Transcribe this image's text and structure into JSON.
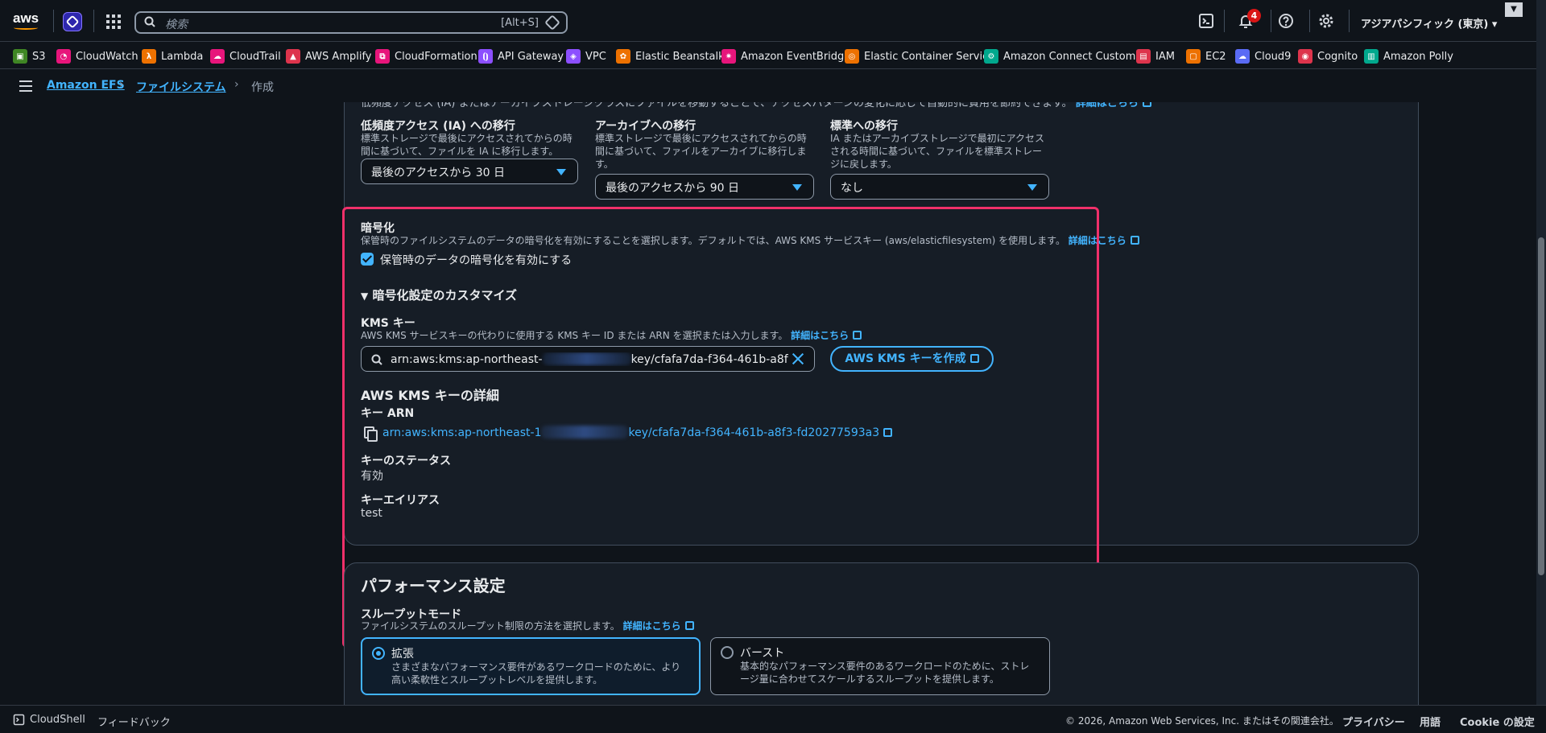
{
  "topnav": {
    "search_placeholder": "検索",
    "search_shortcut": "[Alt+S]",
    "notification_count": "4",
    "region": "アジアパシフィック (東京)"
  },
  "favorites": [
    {
      "label": "S3",
      "color": "#3f8624"
    },
    {
      "label": "CloudWatch",
      "color": "#e7157b"
    },
    {
      "label": "Lambda",
      "color": "#ed7100"
    },
    {
      "label": "CloudTrail",
      "color": "#e7157b"
    },
    {
      "label": "AWS Amplify",
      "color": "#dd344c"
    },
    {
      "label": "CloudFormation",
      "color": "#e7157b"
    },
    {
      "label": "API Gateway",
      "color": "#8c4fff"
    },
    {
      "label": "VPC",
      "color": "#8c4fff"
    },
    {
      "label": "Elastic Beanstalk",
      "color": "#ed7100"
    },
    {
      "label": "Amazon EventBridge",
      "color": "#e7157b"
    },
    {
      "label": "Elastic Container Service",
      "color": "#ed7100"
    },
    {
      "label": "Amazon Connect Customer",
      "color": "#01a88d"
    },
    {
      "label": "IAM",
      "color": "#dd344c"
    },
    {
      "label": "EC2",
      "color": "#ed7100"
    },
    {
      "label": "Cloud9",
      "color": "#5a6bf5"
    },
    {
      "label": "Cognito",
      "color": "#dd344c"
    },
    {
      "label": "Amazon Polly",
      "color": "#01a88d"
    }
  ],
  "breadcrumb": {
    "item1": "Amazon EFS",
    "item2": "ファイルシステム",
    "current": "作成"
  },
  "lifecycle": {
    "intro_cut": "低頻度アクセス (IA) またはアーカイブストレージクラスにファイルを移動することで、アクセスパターンの変化に応じて自動的に費用を節約できます。",
    "intro_link": "詳細はこちら",
    "ia": {
      "label": "低頻度アクセス (IA) への移行",
      "desc": "標準ストレージで最後にアクセスされてからの時間に基づいて、ファイルを IA に移行します。",
      "value": "最後のアクセスから 30 日"
    },
    "archive": {
      "label": "アーカイブへの移行",
      "desc": "標準ストレージで最後にアクセスされてからの時間に基づいて、ファイルをアーカイブに移行します。",
      "value": "最後のアクセスから 90 日"
    },
    "standard": {
      "label": "標準への移行",
      "desc": "IA またはアーカイブストレージで最初にアクセスされる時間に基づいて、ファイルを標準ストレージに戻します。",
      "value": "なし"
    }
  },
  "encryption": {
    "title": "暗号化",
    "desc": "保管時のファイルシステムのデータの暗号化を有効にすることを選択します。デフォルトでは、AWS KMS サービスキー (aws/elasticfilesystem) を使用します。",
    "link": "詳細はこちら",
    "checkbox_label": "保管時のデータの暗号化を有効にする",
    "customize_title": "暗号化設定のカスタマイズ",
    "kms_label": "KMS キー",
    "kms_desc": "AWS KMS サービスキーの代わりに使用する KMS キー ID または ARN を選択または入力します。",
    "kms_link": "詳細はこちら",
    "kms_value_prefix": "arn:aws:kms:ap-northeast-",
    "kms_value_suffix": "key/cfafa7da-f364-461b-a8f3-fd20277593a3",
    "create_key_button": "AWS KMS キーを作成",
    "details_title": "AWS KMS キーの詳細",
    "arn_label": "キー ARN",
    "arn_prefix": "arn:aws:kms:ap-northeast-1",
    "arn_suffix": "key/cfafa7da-f364-461b-a8f3-fd20277593a3",
    "status_label": "キーのステータス",
    "status_value": "有効",
    "alias_label": "キーエイリアス",
    "alias_value": "test"
  },
  "performance": {
    "title": "パフォーマンス設定",
    "throughput_label": "スループットモード",
    "throughput_desc": "ファイルシステムのスループット制限の方法を選択します。",
    "throughput_link": "詳細はこちら",
    "option1_title": "拡張",
    "option1_desc": "さまざまなパフォーマンス要件があるワークロードのために、より高い柔軟性とスループットレベルを提供します。",
    "option2_title": "バースト",
    "option2_desc": "基本的なパフォーマンス要件のあるワークロードのために、ストレージ量に合わせてスケールするスループットを提供します。"
  },
  "footer": {
    "cloudshell": "CloudShell",
    "feedback": "フィードバック",
    "copyright": "© 2026, Amazon Web Services, Inc. またはその関連会社。",
    "privacy": "プライバシー",
    "terms": "用語",
    "cookie": "Cookie の設定"
  }
}
